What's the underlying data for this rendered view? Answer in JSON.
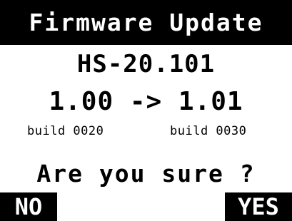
{
  "header": {
    "title": "Firmware Update"
  },
  "device": {
    "model": "HS-20.101"
  },
  "versions": {
    "transition": "1.00 -> 1.01",
    "build_old": "build 0020",
    "build_new": "build 0030"
  },
  "prompt": {
    "question": "Are you sure ?"
  },
  "softkeys": {
    "no_label": "NO",
    "yes_label": "YES"
  },
  "colors": {
    "background": "#ffffff",
    "foreground": "#000000"
  }
}
